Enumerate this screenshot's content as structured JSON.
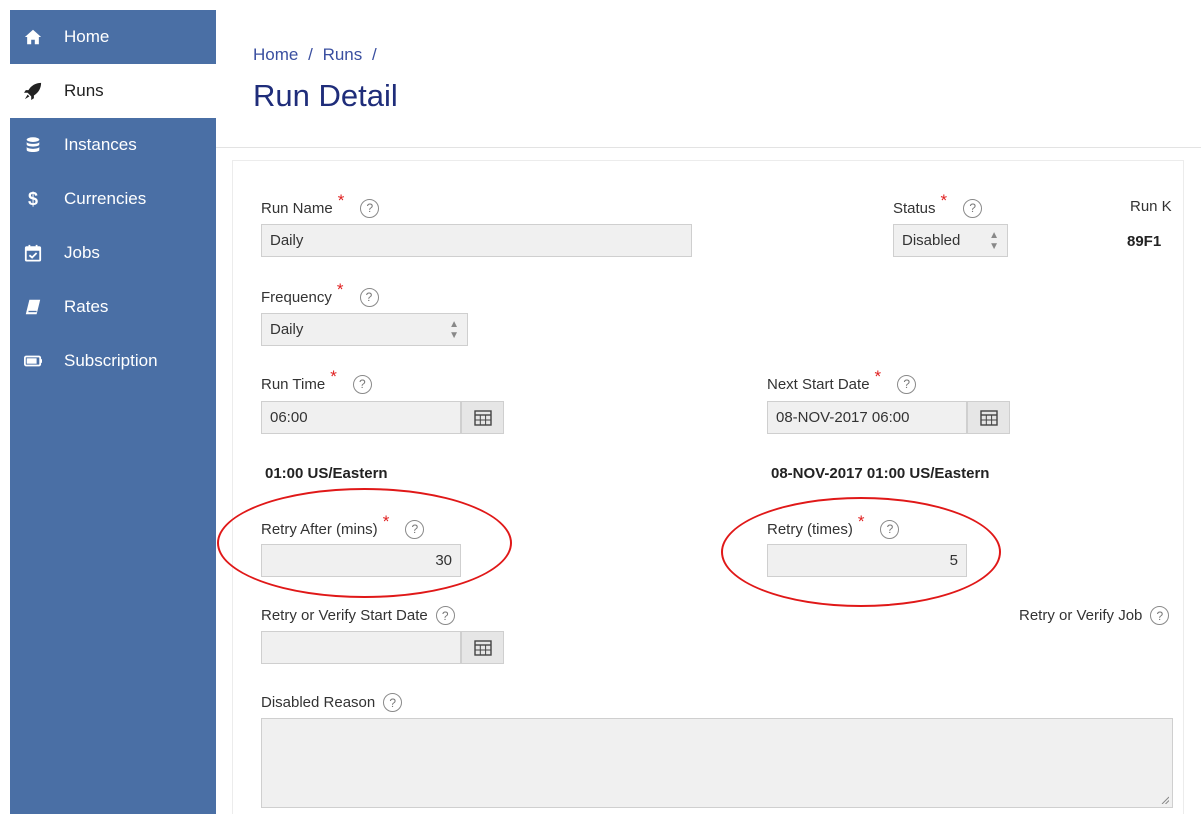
{
  "sidebar": {
    "items": [
      {
        "label": "Home",
        "icon": "home-icon"
      },
      {
        "label": "Runs",
        "icon": "rocket-icon"
      },
      {
        "label": "Instances",
        "icon": "database-icon"
      },
      {
        "label": "Currencies",
        "icon": "dollar-icon"
      },
      {
        "label": "Jobs",
        "icon": "calendar-check-icon"
      },
      {
        "label": "Rates",
        "icon": "book-icon"
      },
      {
        "label": "Subscription",
        "icon": "card-icon"
      }
    ],
    "active": "Runs",
    "bg_color": "#4a6fa5"
  },
  "breadcrumb": {
    "home": "Home",
    "sep1": "/",
    "runs": "Runs",
    "sep2": "/"
  },
  "page_title": "Run Detail",
  "form": {
    "run_name": {
      "label": "Run Name",
      "value": "Daily"
    },
    "status": {
      "label": "Status",
      "value": "Disabled"
    },
    "run_key": {
      "label": "Run K",
      "value": "89F1"
    },
    "frequency": {
      "label": "Frequency",
      "value": "Daily"
    },
    "run_time": {
      "label": "Run Time",
      "value": "06:00",
      "converted": "01:00 US/Eastern"
    },
    "next_start_date": {
      "label": "Next Start Date",
      "value": "08-NOV-2017 06:00",
      "converted": "08-NOV-2017 01:00 US/Eastern"
    },
    "retry_after": {
      "label": "Retry After (mins)",
      "value": "30"
    },
    "retry_times": {
      "label": "Retry (times)",
      "value": "5"
    },
    "retry_verify_start_date": {
      "label": "Retry or Verify Start Date",
      "value": ""
    },
    "retry_verify_job": {
      "label": "Retry or Verify Job"
    },
    "disabled_reason": {
      "label": "Disabled Reason",
      "value": ""
    }
  },
  "required_mark": "*",
  "help_glyph": "?",
  "annotation_color": "#e01818"
}
